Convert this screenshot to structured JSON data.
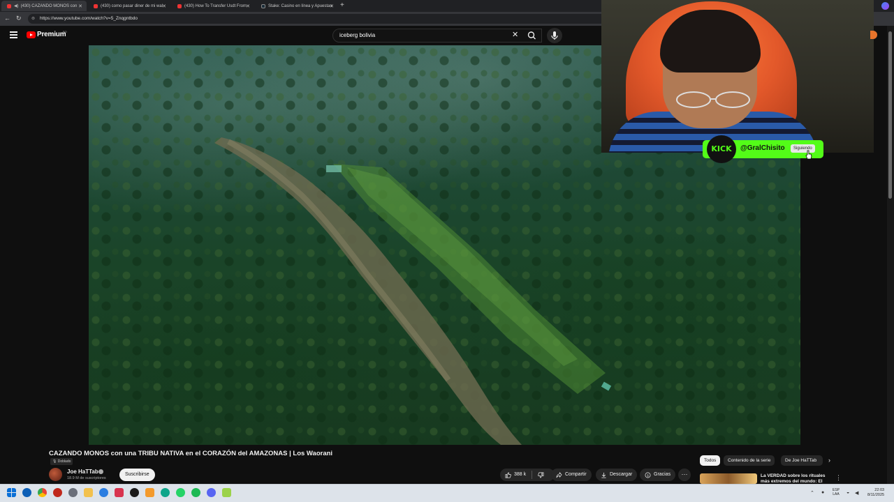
{
  "browser": {
    "tabs": [
      {
        "title": "(430) CAZANDO MONOS con",
        "active": true
      },
      {
        "title": "(430) como pasar diner de mi wal",
        "active": false
      },
      {
        "title": "(430) How To Transfer Usdt From",
        "active": false
      },
      {
        "title": "Stake: Casino en línea y Apuestas",
        "active": false
      }
    ],
    "new_tab": "+",
    "url": "https://www.youtube.com/watch?v=5_Znqgntbdo"
  },
  "youtube": {
    "logo_text": "Premium",
    "region": "BO",
    "search_value": "iceberg bolivia",
    "video": {
      "title": "CAZANDO MONOS con una TRIBU NATIVA en el CORAZÓN del AMAZONAS | Los Waorani",
      "dubbed_badge": "Doblado",
      "channel_name": "Joe HaTTab",
      "subscribers": "18.9 M de suscriptores",
      "subscribe_label": "Suscribirse",
      "likes": "388 k",
      "share_label": "Compartir",
      "download_label": "Descargar",
      "thanks_label": "Gracias",
      "more_label": "···"
    },
    "chips": [
      "Todos",
      "Contenido de la serie",
      "De Joe HaTTab"
    ],
    "recommendation": {
      "title": "La VERDAD sobre los rituales más extremos del mundo: El"
    }
  },
  "overlay": {
    "kick_logo": "KICK",
    "kick_user": "@GralChisito",
    "follow_state": "Siguiendo"
  },
  "taskbar": {
    "lang_line1": "ESP",
    "lang_line2": "LAA",
    "time": "22:03",
    "date": "8/11/2025"
  },
  "colors": {
    "kick_green": "#53fc18",
    "yt_red": "#ff0000",
    "background": "#0f0f0f"
  }
}
